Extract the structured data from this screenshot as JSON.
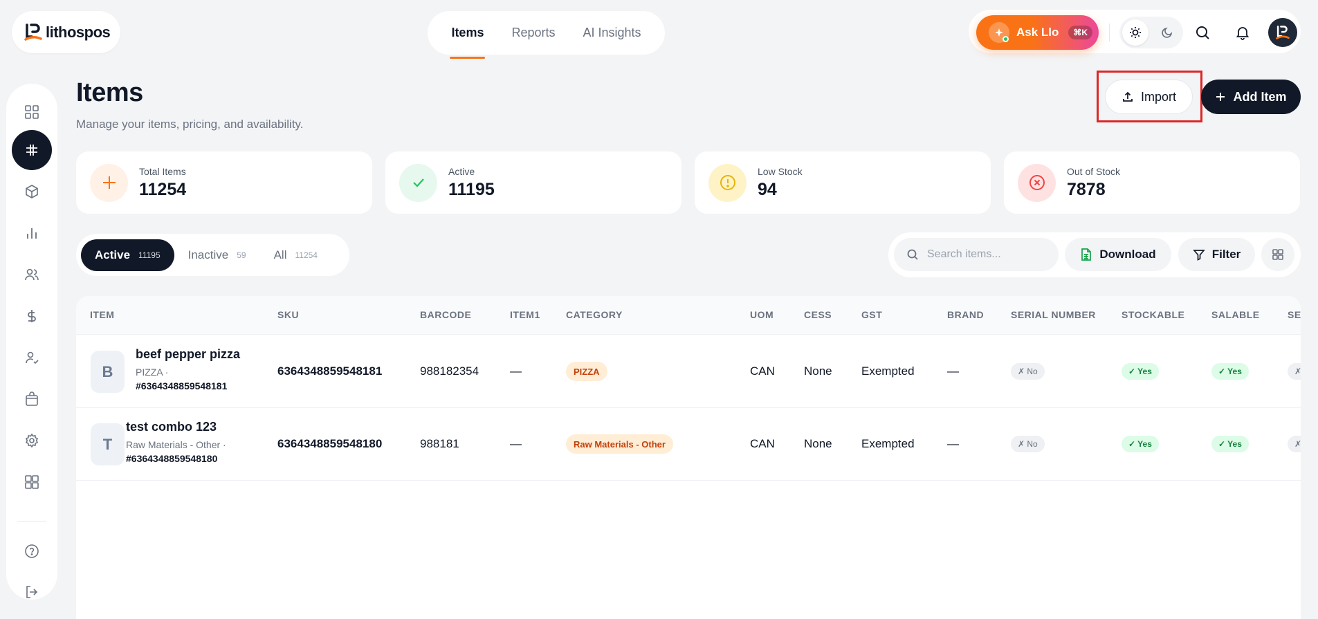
{
  "brand": {
    "name": "lithospos"
  },
  "topnav": {
    "items": [
      "Items",
      "Reports",
      "AI Insights"
    ],
    "active": "Items"
  },
  "ask": {
    "label": "Ask Llo",
    "shortcut": "⌘K"
  },
  "page": {
    "title": "Items",
    "subtitle": "Manage your items, pricing, and availability.",
    "import_label": "Import",
    "add_label": "Add Item"
  },
  "stats": [
    {
      "label": "Total Items",
      "value": "11254",
      "icon": "plus-icon",
      "color": "#f97316"
    },
    {
      "label": "Active",
      "value": "11195",
      "icon": "check-icon",
      "color": "#22c55e"
    },
    {
      "label": "Low Stock",
      "value": "94",
      "icon": "alert-circle-icon",
      "color": "#eab308"
    },
    {
      "label": "Out of Stock",
      "value": "7878",
      "icon": "x-circle-icon",
      "color": "#ef4444"
    }
  ],
  "tabs": [
    {
      "label": "Active",
      "count": "11195"
    },
    {
      "label": "Inactive",
      "count": "59"
    },
    {
      "label": "All",
      "count": "11254"
    }
  ],
  "toolbar": {
    "search_placeholder": "Search items...",
    "download_label": "Download",
    "filter_label": "Filter"
  },
  "table": {
    "columns": [
      "ITEM",
      "SKU",
      "BARCODE",
      "ITEM1",
      "CATEGORY",
      "UOM",
      "CESS",
      "GST",
      "BRAND",
      "SERIAL NUMBER",
      "STOCKABLE",
      "SALABLE",
      "SE"
    ],
    "rows": [
      {
        "initial": "B",
        "name": "beef pepper pizza",
        "sub": "PIZZA ·",
        "code": "#6364348859548181",
        "sku": "6364348859548181",
        "barcode": "988182354",
        "item1": "—",
        "category": "PIZZA",
        "uom": "CAN",
        "cess": "None",
        "gst": "Exempted",
        "brand": "—",
        "serial": "✗ No",
        "stockable": "✓ Yes",
        "salable": "✓ Yes",
        "extra": "✗"
      },
      {
        "initial": "T",
        "name": "test combo 123",
        "sub": "Raw Materials - Other ·",
        "code": "#6364348859548180",
        "sku": "6364348859548180",
        "barcode": "988181",
        "item1": "—",
        "category": "Raw Materials - Other",
        "uom": "CAN",
        "cess": "None",
        "gst": "Exempted",
        "brand": "—",
        "serial": "✗ No",
        "stockable": "✓ Yes",
        "salable": "✓ Yes",
        "extra": "✗"
      }
    ]
  },
  "sidebar": {
    "items": [
      "dashboard-icon",
      "items-icon",
      "box-icon",
      "chart-icon",
      "users-icon",
      "dollar-icon",
      "user-check-icon",
      "shopping-bag-icon",
      "settings-icon",
      "apps-icon",
      "help-icon",
      "logout-icon"
    ],
    "active": "items-icon"
  }
}
